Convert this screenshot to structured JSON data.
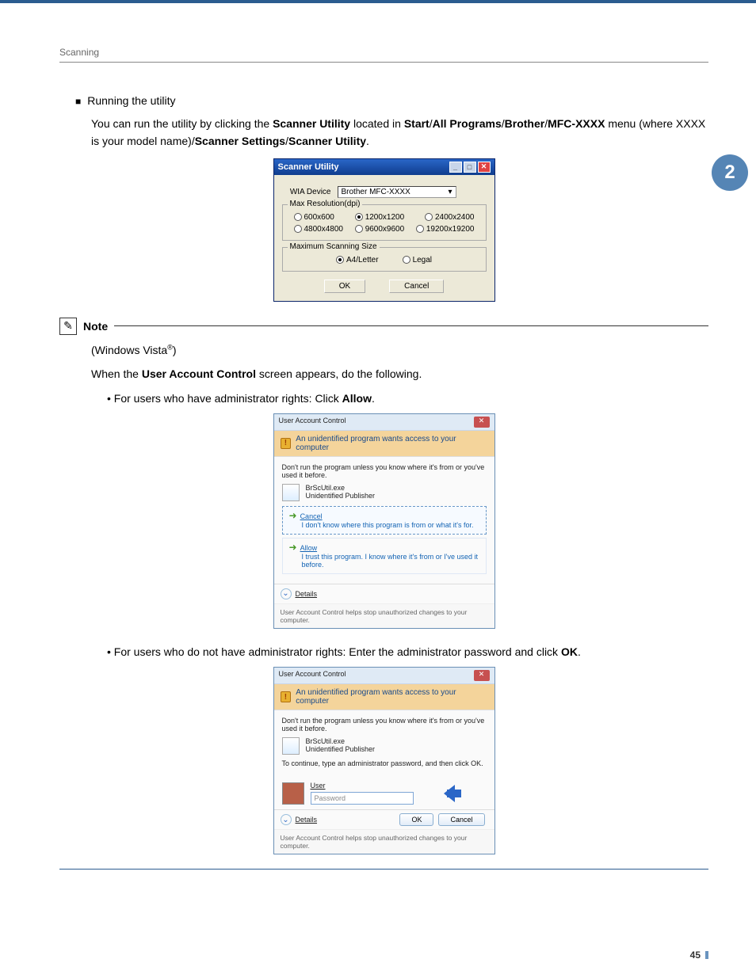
{
  "header": {
    "small": "Scanning"
  },
  "tab": {
    "label": "2"
  },
  "section": {
    "title": "Running the utility"
  },
  "para1": {
    "lead": "You can run the utility by clicking the ",
    "b1": "Scanner Utility",
    "mid1": " located in ",
    "b2": "Start",
    "sep": "/",
    "b3": "All Programs",
    "b4": "Brother",
    "b5": "MFC-XXXX",
    "line2a": " menu (where XXXX is your model name)/",
    "b6": "Scanner Settings",
    "b7": "Scanner Utility",
    "end": "."
  },
  "dlg1": {
    "title": "Scanner Utility",
    "device_label": "WIA Device",
    "device_value": "Brother  MFC-XXXX",
    "group1": "Max Resolution(dpi)",
    "res": [
      "600x600",
      "1200x1200",
      "2400x2400",
      "4800x4800",
      "9600x9600",
      "19200x19200"
    ],
    "res_selected": 1,
    "group2": "Maximum Scanning Size",
    "size": [
      "A4/Letter",
      "Legal"
    ],
    "size_selected": 0,
    "ok": "OK",
    "cancel": "Cancel"
  },
  "note": {
    "title": "Note",
    "vista1": "(Windows Vista",
    "vista2": ")",
    "reg": "®",
    "line2a": "When the ",
    "line2b": "User Account Control",
    "line2c": " screen appears, do the following.",
    "bullet1a": "For users who have administrator rights: Click ",
    "bullet1b": "Allow",
    "bullet1c": ".",
    "bullet2a": "For users who do not have administrator rights: Enter the administrator password and click ",
    "bullet2b": "OK",
    "bullet2c": "."
  },
  "uac": {
    "title": "User Account Control",
    "banner": "An unidentified program wants access to your computer",
    "warn": "Don't run the program unless you know where it's from or you've used it before.",
    "prog_name": "BrScUtil.exe",
    "prog_pub": "Unidentified Publisher",
    "cancel": "Cancel",
    "cancel_sub": "I don't know where this program is from or what it's for.",
    "allow": "Allow",
    "allow_sub": "I trust this program. I know where it's from or I've used it before.",
    "details": "Details",
    "footer": "User Account Control helps stop unauthorized changes to your computer.",
    "cont": "To continue, type an administrator password, and then click OK.",
    "user": "User",
    "pass": "Password",
    "ok": "OK",
    "cancel_btn": "Cancel"
  },
  "page": {
    "num": "45"
  }
}
